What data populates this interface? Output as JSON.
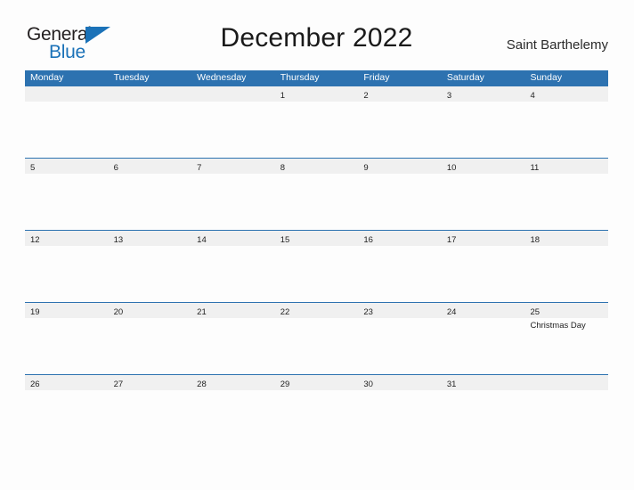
{
  "logo": {
    "word_top": "General",
    "word_bottom": "Blue",
    "flag_icon": "triangle-flag-icon",
    "brand_color": "#1b72b8"
  },
  "header": {
    "title": "December 2022",
    "locale": "Saint Barthelemy"
  },
  "colors": {
    "header_blue": "#2d72b0",
    "band_gray": "#f0f0f0",
    "page_background": "#fdfdfd",
    "text": "#1f1f1f"
  },
  "calendar": {
    "month": "December",
    "year": "2022",
    "weekday_headers": [
      "Monday",
      "Tuesday",
      "Wednesday",
      "Thursday",
      "Friday",
      "Saturday",
      "Sunday"
    ],
    "weeks": [
      {
        "days": [
          {
            "num": "",
            "event": ""
          },
          {
            "num": "",
            "event": ""
          },
          {
            "num": "",
            "event": ""
          },
          {
            "num": "1",
            "event": ""
          },
          {
            "num": "2",
            "event": ""
          },
          {
            "num": "3",
            "event": ""
          },
          {
            "num": "4",
            "event": ""
          }
        ]
      },
      {
        "days": [
          {
            "num": "5",
            "event": ""
          },
          {
            "num": "6",
            "event": ""
          },
          {
            "num": "7",
            "event": ""
          },
          {
            "num": "8",
            "event": ""
          },
          {
            "num": "9",
            "event": ""
          },
          {
            "num": "10",
            "event": ""
          },
          {
            "num": "11",
            "event": ""
          }
        ]
      },
      {
        "days": [
          {
            "num": "12",
            "event": ""
          },
          {
            "num": "13",
            "event": ""
          },
          {
            "num": "14",
            "event": ""
          },
          {
            "num": "15",
            "event": ""
          },
          {
            "num": "16",
            "event": ""
          },
          {
            "num": "17",
            "event": ""
          },
          {
            "num": "18",
            "event": ""
          }
        ]
      },
      {
        "days": [
          {
            "num": "19",
            "event": ""
          },
          {
            "num": "20",
            "event": ""
          },
          {
            "num": "21",
            "event": ""
          },
          {
            "num": "22",
            "event": ""
          },
          {
            "num": "23",
            "event": ""
          },
          {
            "num": "24",
            "event": ""
          },
          {
            "num": "25",
            "event": "Christmas Day"
          }
        ]
      },
      {
        "days": [
          {
            "num": "26",
            "event": ""
          },
          {
            "num": "27",
            "event": ""
          },
          {
            "num": "28",
            "event": ""
          },
          {
            "num": "29",
            "event": ""
          },
          {
            "num": "30",
            "event": ""
          },
          {
            "num": "31",
            "event": ""
          },
          {
            "num": "",
            "event": ""
          }
        ]
      }
    ]
  }
}
